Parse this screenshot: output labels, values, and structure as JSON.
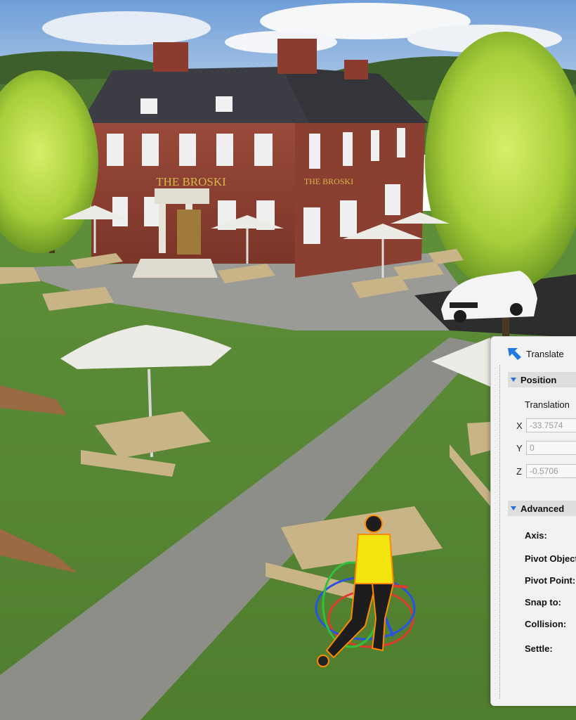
{
  "scene": {
    "pub_sign": "THE BROSKI",
    "pub_sign_side": "THE BROSKI"
  },
  "icons": {
    "tool": "translate-arrow-icon",
    "position_chevron": "chevron-down-icon",
    "advanced_chevron": "chevron-down-icon"
  },
  "colors": {
    "accent": "#2b6fd6"
  },
  "panel": {
    "tool_label": "Translate",
    "position": {
      "title": "Position",
      "subtitle": "Translation",
      "x_label": "X",
      "x_value": "-33.7574",
      "y_label": "Y",
      "y_value": "0",
      "z_label": "Z",
      "z_value": "-0.5706"
    },
    "advanced": {
      "title": "Advanced",
      "items": [
        "Axis:",
        "Pivot Object",
        "Pivot Point:",
        "Snap to:",
        "Collision:",
        "Settle:"
      ]
    }
  }
}
